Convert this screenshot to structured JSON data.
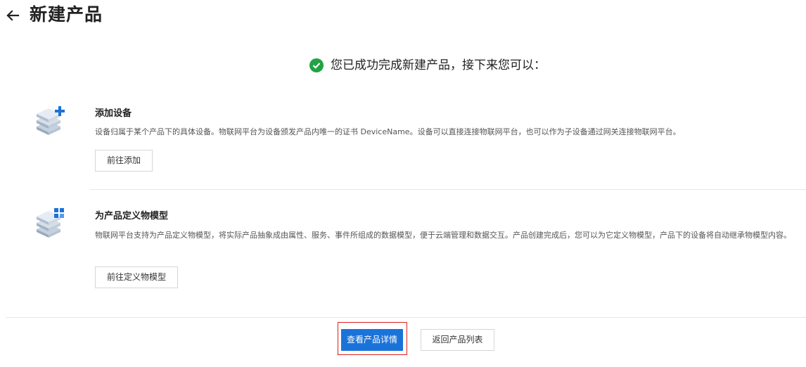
{
  "header": {
    "title": "新建产品"
  },
  "success": {
    "message": "您已成功完成新建产品，接下来您可以："
  },
  "sections": [
    {
      "title": "添加设备",
      "description": "设备归属于某个产品下的具体设备。物联网平台为设备颁发产品内唯一的证书 DeviceName。设备可以直接连接物联网平台，也可以作为子设备通过网关连接物联网平台。",
      "button_label": "前往添加",
      "icon": "add-device-icon"
    },
    {
      "title": "为产品定义物模型",
      "description": "物联网平台支持为产品定义物模型，将实际产品抽象成由属性、服务、事件所组成的数据模型，便于云端管理和数据交互。产品创建完成后，您可以为它定义物模型，产品下的设备将自动继承物模型内容。",
      "button_label": "前往定义物模型",
      "icon": "thing-model-icon"
    }
  ],
  "footer": {
    "primary_label": "查看产品详情",
    "secondary_label": "返回产品列表"
  },
  "colors": {
    "primary": "#1a73d9",
    "success": "#23a244",
    "highlight": "#e02020"
  }
}
